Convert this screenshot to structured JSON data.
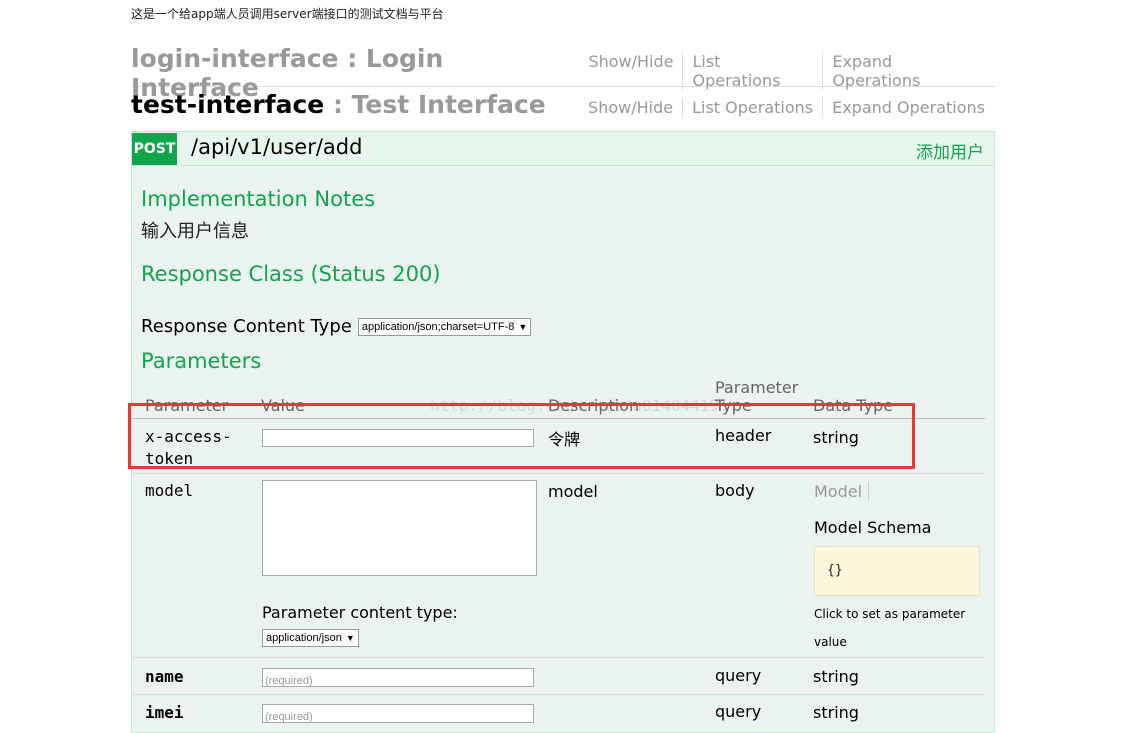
{
  "intro_text": "这是一个给app端人员调用server端接口的测试文档与平台",
  "resources": [
    {
      "name": "login-interface",
      "separator": " : ",
      "description": "Login Interface"
    },
    {
      "name": "test-interface",
      "separator": " : ",
      "description": "Test Interface"
    }
  ],
  "ops_links": {
    "show_hide": "Show/Hide",
    "list_operations": "List Operations",
    "expand_operations": "Expand Operations"
  },
  "operation": {
    "method": "POST",
    "path": "/api/v1/user/add",
    "summary": "添加用户",
    "impl_notes_heading": "Implementation Notes",
    "impl_notes_text": "输入用户信息",
    "response_class_heading": "Response Class (Status 200)",
    "response_content_type_label": "Response Content Type",
    "response_content_type_value": "application/json;charset=UTF-8",
    "parameters_heading": "Parameters"
  },
  "param_table": {
    "headers": {
      "parameter": "Parameter",
      "value": "Value",
      "description": "Description",
      "param_type_line1": "Parameter",
      "param_type_line2": "Type",
      "data_type": "Data Type"
    },
    "watermark": "http://blog.csdn.net/u01404419"
  },
  "params": [
    {
      "name_line1": "x-access-",
      "name_line2": "token",
      "description": "令牌",
      "param_type": "header",
      "data_type": "string",
      "value": ""
    },
    {
      "name": "model",
      "description": "model",
      "param_type": "body",
      "content_type_label": "Parameter content type:",
      "content_type_value": "application/json",
      "model_tab": "Model",
      "model_schema_tab": "Model Schema",
      "schema_text": "{}",
      "click_note": "Click to set as parameter value"
    },
    {
      "name": "name",
      "placeholder": "(required)",
      "param_type": "query",
      "data_type": "string"
    },
    {
      "name": "imei",
      "placeholder": "(required)",
      "param_type": "query",
      "data_type": "string"
    }
  ],
  "colors": {
    "accent_green": "#10a54a",
    "highlight_red": "#e23a3a",
    "op_bg": "#ebf3f0"
  }
}
